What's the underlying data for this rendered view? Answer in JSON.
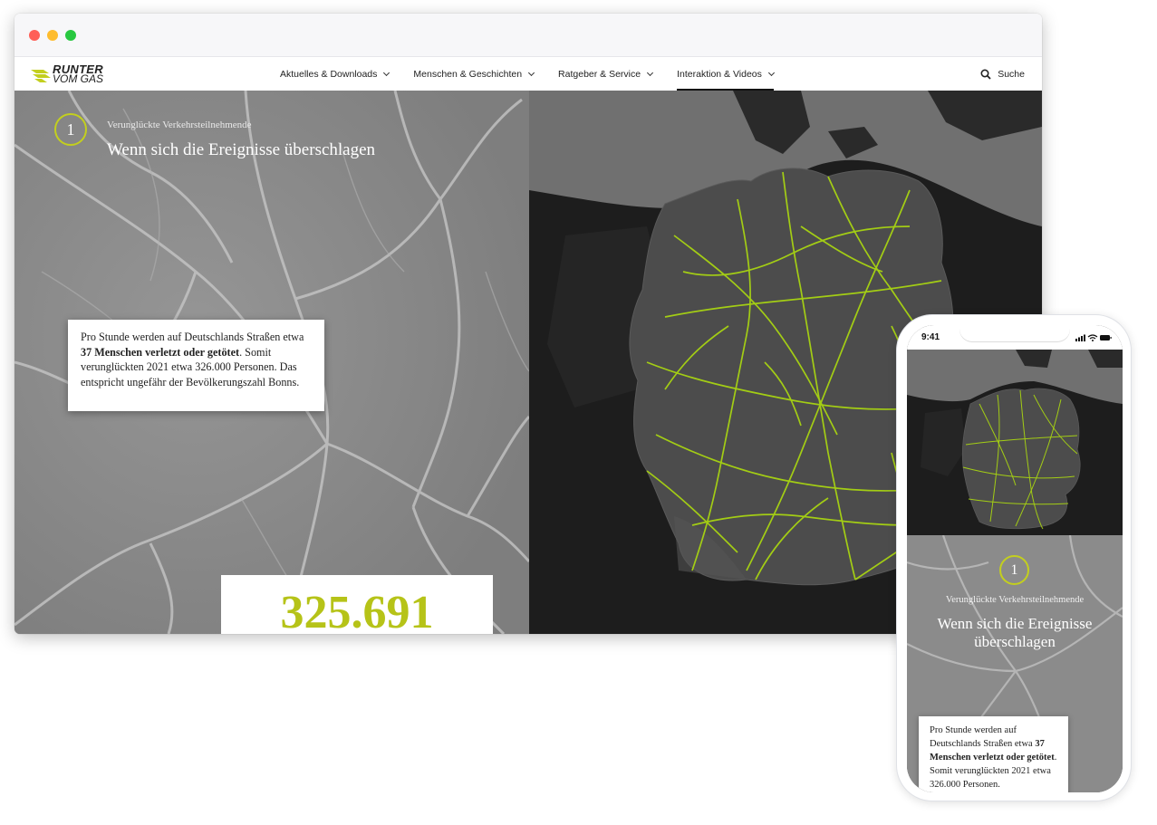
{
  "nav": {
    "logo_line1": "RUNTER",
    "logo_line2": "VOM GAS",
    "items": [
      {
        "label": "Aktuelles & Downloads"
      },
      {
        "label": "Menschen & Geschichten"
      },
      {
        "label": "Ratgeber & Service"
      },
      {
        "label": "Interaktion & Videos"
      }
    ],
    "active_item": "Interaktion & Videos",
    "search_label": "Suche"
  },
  "story": {
    "step_number": "1",
    "eyebrow": "Verunglückte Verkehrsteilnehmende",
    "headline": "Wenn sich die Ereignisse überschlagen",
    "card_text_1": "Pro Stunde werden auf Deutschlands Straßen etwa ",
    "card_text_bold": "37 Menschen verletzt oder getötet",
    "card_text_2": ". Somit verunglückten 2021 etwa 326.000 Personen. Das entspricht ungefähr der Bevölkerungszahl Bonns.",
    "counter": "325.691"
  },
  "mobile": {
    "status_time": "9:41",
    "card_text_1": "Pro Stunde werden auf Deutschlands Straßen etwa ",
    "card_text_bold": "37 Menschen verletzt oder getötet",
    "card_text_2": ". Somit verunglückten 2021 etwa 326.000 Personen."
  },
  "colors": {
    "accent": "#c3cf1e",
    "road_lines": "#a8d412",
    "map_background": "#1d1d1d",
    "country_fill": "#4a4a4a",
    "story_background": "#8d8d8d"
  }
}
